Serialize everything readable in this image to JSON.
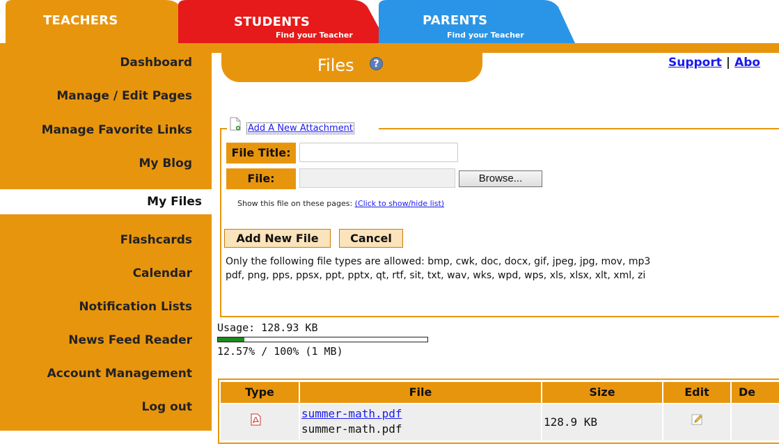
{
  "tabs": {
    "teachers": {
      "label": "TEACHERS",
      "color": "#e8950e"
    },
    "students": {
      "label": "STUDENTS",
      "sub": "Find your Teacher",
      "color": "#e61a1a"
    },
    "parents": {
      "label": "PARENTS",
      "sub": "Find your Teacher",
      "color": "#2a95e6"
    }
  },
  "sidebar": {
    "items": [
      {
        "label": "Dashboard"
      },
      {
        "label": "Manage / Edit Pages"
      },
      {
        "label": "Manage Favorite Links"
      },
      {
        "label": "My Blog"
      },
      {
        "label": "My Files",
        "active": true
      },
      {
        "label": "Flashcards"
      },
      {
        "label": "Calendar"
      },
      {
        "label": "Notification Lists"
      },
      {
        "label": "News Feed Reader"
      },
      {
        "label": "Account Management"
      },
      {
        "label": "Log out"
      }
    ]
  },
  "header": {
    "title": "Files",
    "help_icon": "question-icon",
    "links": {
      "support": "Support",
      "separator": "|",
      "about": "Abo"
    }
  },
  "attachment": {
    "link": "Add A New Attachment",
    "file_title_label": "File Title:",
    "file_title_value": "",
    "file_label": "File:",
    "file_value": "",
    "browse_label": "Browse...",
    "show_text": "Show this file on these pages:",
    "show_link": "(Click to show/hide list)",
    "add_button": "Add New File",
    "cancel_button": "Cancel",
    "allowed_line1": "Only the following file types are allowed: bmp, cwk, doc, docx, gif, jpeg, jpg, mov, mp3",
    "allowed_line2": "pdf, png, pps, ppsx, ppt, pptx, qt, rtf, sit, txt, wav, wks, wpd, wps, xls, xlsx, xlt, xml, zi"
  },
  "usage": {
    "label": "Usage: 128.93 KB",
    "percent_text": "12.57% / 100% (1 MB)",
    "fraction": 0.1257,
    "bar_color": "#1a8a1a"
  },
  "table": {
    "headers": [
      "Type",
      "File",
      "Size",
      "Edit",
      "De"
    ],
    "rows": [
      {
        "type_icon": "pdf-icon",
        "file_link": "summer-math.pdf",
        "file_name": "summer-math.pdf",
        "size": "128.9 KB",
        "edit_icon": "pencil-icon"
      }
    ]
  }
}
